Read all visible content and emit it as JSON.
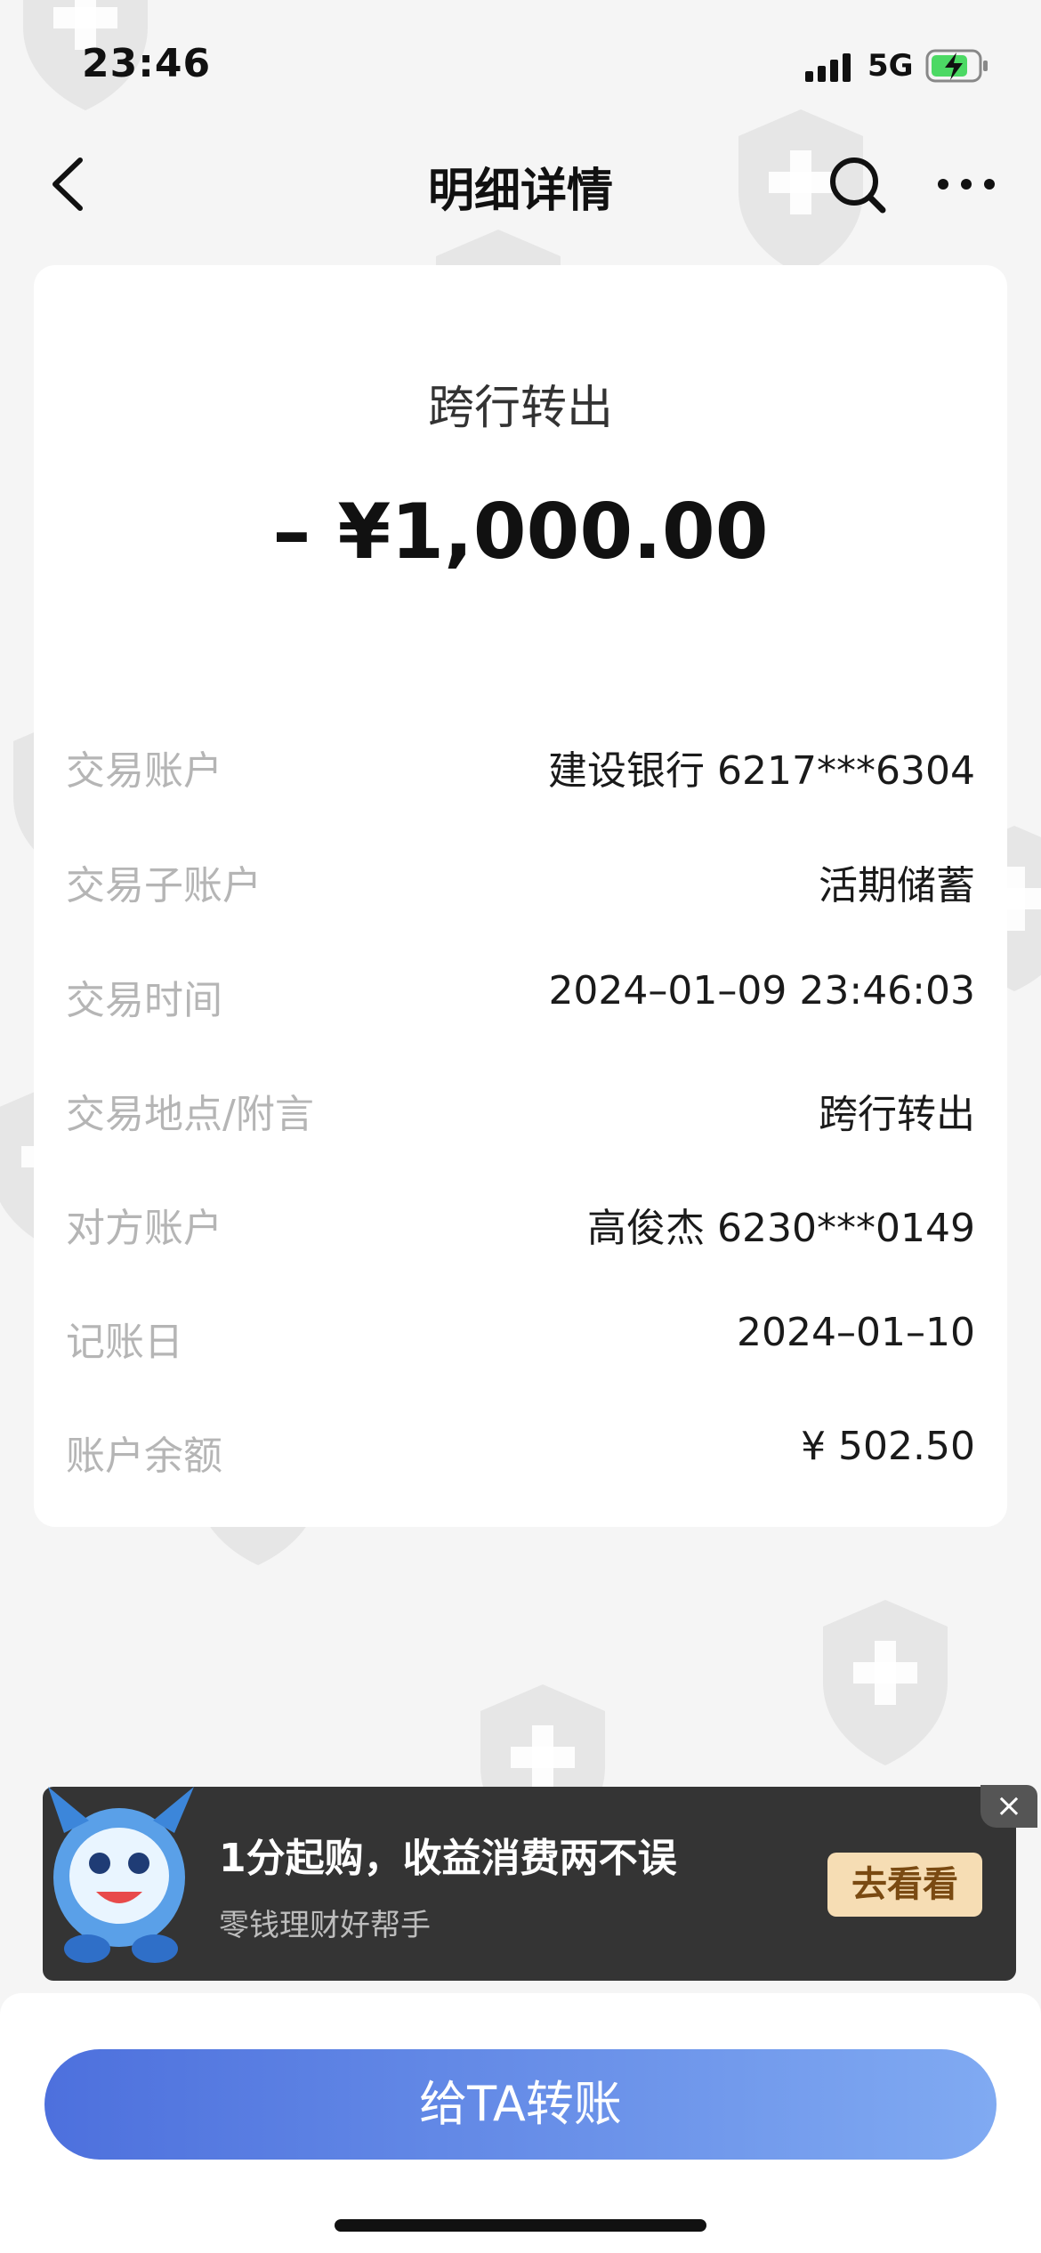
{
  "status_bar": {
    "time": "23:46",
    "network": "5G"
  },
  "nav": {
    "title": "明细详情"
  },
  "transaction": {
    "type": "跨行转出",
    "amount": "– ¥1,000.00",
    "details": [
      {
        "label": "交易账户",
        "value": "建设银行 6217***6304"
      },
      {
        "label": "交易子账户",
        "value": "活期储蓄"
      },
      {
        "label": "交易时间",
        "value": "2024–01–09 23:46:03"
      },
      {
        "label": "交易地点/附言",
        "value": "跨行转出"
      },
      {
        "label": "对方账户",
        "value": "高俊杰 6230***0149"
      },
      {
        "label": "记账日",
        "value": "2024–01–10"
      },
      {
        "label": "账户余额",
        "value": "¥ 502.50"
      }
    ]
  },
  "promo": {
    "title": "1分起购，收益消费两不误",
    "subtitle": "零钱理财好帮手",
    "button": "去看看",
    "close": "×"
  },
  "bottom": {
    "transfer_button": "给TA转账"
  },
  "icons": [
    "back-icon",
    "search-icon",
    "more-icon",
    "signal-icon",
    "battery-charging-icon",
    "mascot-icon",
    "close-icon"
  ],
  "colors": {
    "accent_start": "#4d70dd",
    "accent_end": "#80aaf2",
    "promo_bg": "#343434",
    "promo_button": "#f6ddb4"
  }
}
